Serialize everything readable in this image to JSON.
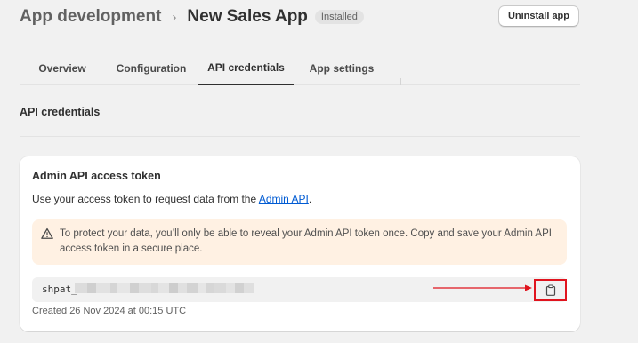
{
  "header": {
    "breadcrumb": "App development",
    "separator": "›",
    "title": "New Sales App",
    "badge": "Installed",
    "uninstall_label": "Uninstall app"
  },
  "tabs": [
    {
      "label": "Overview",
      "active": false
    },
    {
      "label": "Configuration",
      "active": false
    },
    {
      "label": "API credentials",
      "active": true
    },
    {
      "label": "App settings",
      "active": false
    }
  ],
  "section": {
    "title": "API credentials"
  },
  "card": {
    "title": "Admin API access token",
    "desc_prefix": "Use your access token to request data from the ",
    "desc_link": "Admin API",
    "desc_suffix": ".",
    "banner_icon": "warning-icon",
    "banner_color": "#fff1e3",
    "banner_text": "To protect your data, you’ll only be able to reveal your Admin API token once. Copy and save your Admin API access token in a secure place.",
    "token_prefix": "shpat_",
    "copy_icon": "clipboard-icon",
    "annotation_color": "#e0141e",
    "created": "Created 26 Nov 2024 at 00:15 UTC"
  }
}
